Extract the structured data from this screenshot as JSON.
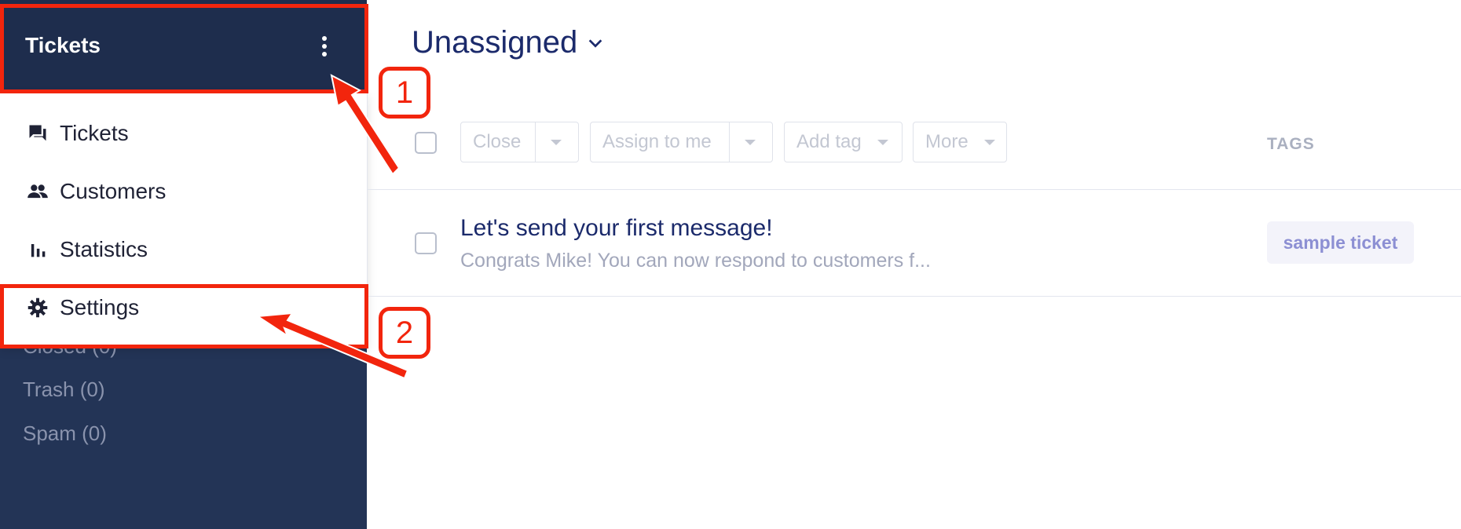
{
  "sidebar": {
    "title": "Tickets",
    "menu": [
      {
        "label": "Tickets",
        "icon": "chat-bubbles-icon"
      },
      {
        "label": "Customers",
        "icon": "people-icon"
      },
      {
        "label": "Statistics",
        "icon": "bar-chart-icon"
      },
      {
        "label": "Settings",
        "icon": "gear-icon"
      }
    ],
    "folders": [
      {
        "label": "Closed (0)"
      },
      {
        "label": "Trash (0)"
      },
      {
        "label": "Spam (0)"
      }
    ]
  },
  "main": {
    "title": "Unassigned",
    "toolbar": {
      "close": "Close",
      "assign": "Assign to me",
      "add_tag": "Add tag",
      "more": "More"
    },
    "tags_header": "TAGS",
    "tickets": [
      {
        "title": "Let's send your first message!",
        "snippet": "Congrats Mike! You can now respond to customers f...",
        "tag": "sample ticket"
      }
    ]
  },
  "annotations": {
    "step1": "1",
    "step2": "2"
  },
  "colors": {
    "sidebar_bg": "#233456",
    "header_bg": "#1e2d4d",
    "accent_title": "#1b2a6b",
    "annotation_red": "#f2250d"
  }
}
